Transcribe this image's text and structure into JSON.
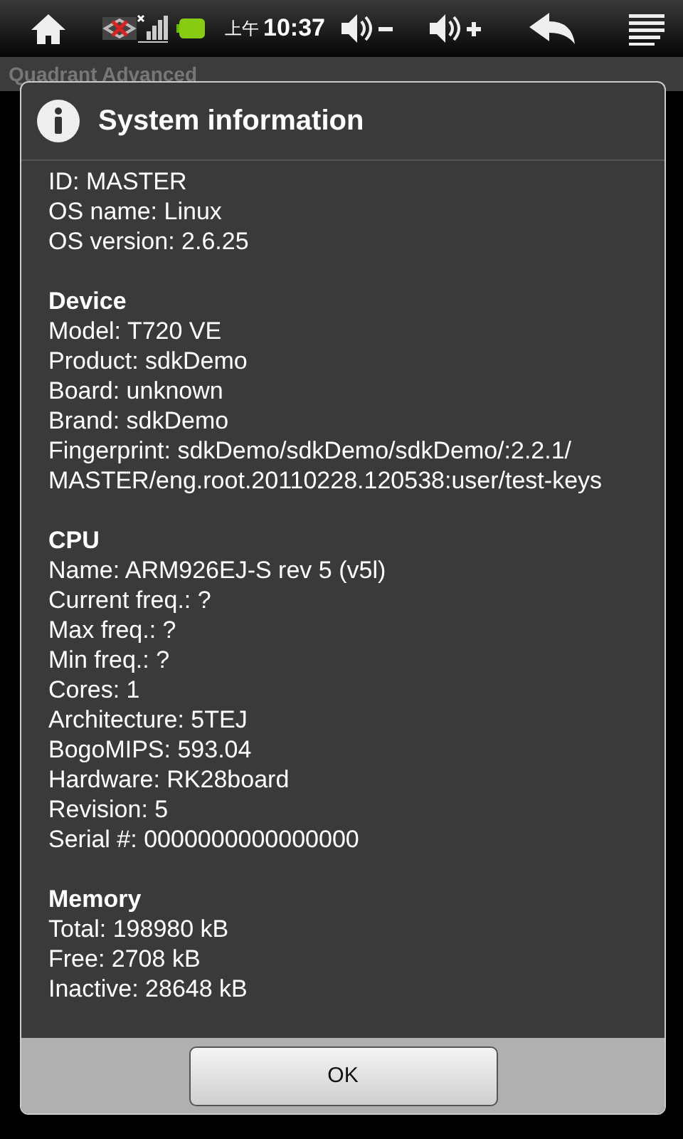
{
  "status_bar": {
    "period": "上午",
    "time": "10:37"
  },
  "app": {
    "title": "Quadrant Advanced"
  },
  "dialog": {
    "title": "System information",
    "sections": [
      {
        "lines": [
          "ID: MASTER",
          "OS name: Linux",
          "OS version: 2.6.25"
        ]
      },
      {
        "heading": "Device",
        "lines": [
          "Model: T720 VE",
          "Product: sdkDemo",
          "Board: unknown",
          "Brand: sdkDemo",
          "Fingerprint: sdkDemo/sdkDemo/sdkDemo/:2.2.1/",
          "MASTER/eng.root.20110228.120538:user/test-keys"
        ]
      },
      {
        "heading": "CPU",
        "lines": [
          "Name: ARM926EJ-S rev 5 (v5l)",
          "Current freq.: ?",
          "Max freq.: ?",
          "Min freq.: ?",
          "Cores: 1",
          "Architecture: 5TEJ",
          "BogoMIPS: 593.04",
          "Hardware: RK28board",
          "Revision: 5",
          "Serial #: 0000000000000000"
        ]
      },
      {
        "heading": "Memory",
        "lines": [
          "Total: 198980 kB",
          "Free: 2708 kB",
          "Inactive: 28648 kB"
        ]
      }
    ],
    "buttons": [
      "OK"
    ]
  }
}
